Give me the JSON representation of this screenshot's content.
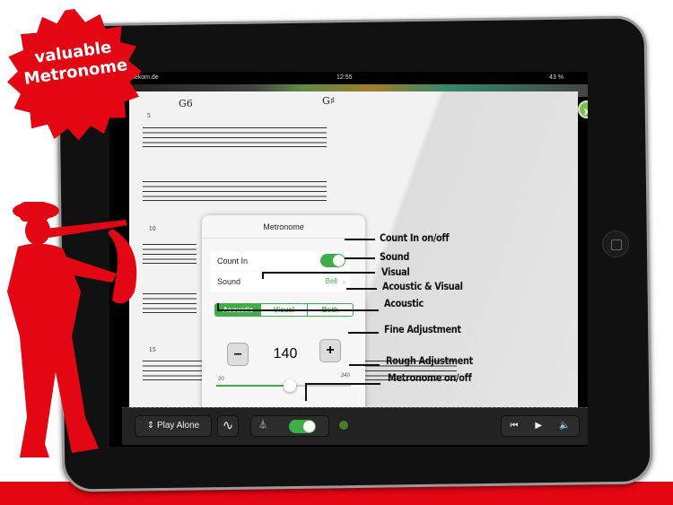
{
  "badge": {
    "line1": "valuable",
    "line2": "Metronome"
  },
  "status": {
    "carrier": "...ekom.de",
    "time": "12:55",
    "battery": "43 %"
  },
  "sheet": {
    "chord1": "G6",
    "chord2": "G♯",
    "measure1": "5",
    "measure2": "10",
    "measure3": "15",
    "close": "x"
  },
  "popup": {
    "title": "Metronome",
    "count_in_label": "Count In",
    "count_in_on": true,
    "sound_label": "Sound",
    "sound_value": "Bell",
    "sound_chevron": "›",
    "modes": [
      "Acoustic",
      "Visual",
      "Both"
    ],
    "selected_mode": "Acoustic",
    "minus": "–",
    "plus": "+",
    "tempo": "140",
    "slider_min": "20",
    "slider_max": "240",
    "slider_value": 140
  },
  "toolbar": {
    "play_mode": "Play Alone",
    "play_mode_icon": "⇕",
    "wave_icon": "∿",
    "metronome_icon": "⏃",
    "metronome_on": true,
    "rewind": "⏮",
    "play": "▶",
    "volume": "🔈"
  },
  "annotations": [
    "Count In on/off",
    "Sound",
    "Visual",
    "Acoustic & Visual",
    "Acoustic",
    "Fine Adjustment",
    "Rough Adjustment",
    "Metronome on/off"
  ],
  "colors": {
    "accent": "#3fae49",
    "brand_red": "#e30613"
  }
}
